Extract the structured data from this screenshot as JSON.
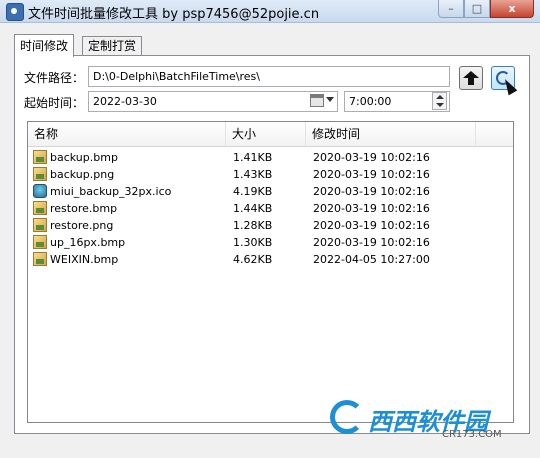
{
  "window": {
    "title": "文件时间批量修改工具 by psp7456@52pojie.cn",
    "minimize_glyph": "–",
    "maximize_glyph": "□",
    "close_glyph": "x"
  },
  "tabs": [
    {
      "label": "时间修改",
      "active": true
    },
    {
      "label": "定制打赏",
      "active": false
    }
  ],
  "form": {
    "path_label": "文件路径：",
    "path_value": "D:\\0-Delphi\\BatchFileTime\\res\\",
    "start_label": "起始时间：",
    "date_value": "2022-03-30",
    "time_value": "7:00:00"
  },
  "icons": {
    "up_button": "up-arrow-icon",
    "refresh_button": "refresh-icon",
    "date_picker": "calendar-icon"
  },
  "file_list": {
    "columns": [
      "名称",
      "大小",
      "修改时间"
    ],
    "rows": [
      {
        "name": "backup.bmp",
        "size": "1.41KB",
        "modified": "2020-03-19 10:02:16",
        "icon": "image-file-icon"
      },
      {
        "name": "backup.png",
        "size": "1.43KB",
        "modified": "2020-03-19 10:02:16",
        "icon": "image-file-icon"
      },
      {
        "name": "miui_backup_32px.ico",
        "size": "4.19KB",
        "modified": "2020-03-19 10:02:16",
        "icon": "ico-file-icon"
      },
      {
        "name": "restore.bmp",
        "size": "1.44KB",
        "modified": "2020-03-19 10:02:16",
        "icon": "image-file-icon"
      },
      {
        "name": "restore.png",
        "size": "1.28KB",
        "modified": "2020-03-19 10:02:16",
        "icon": "image-file-icon"
      },
      {
        "name": "up_16px.bmp",
        "size": "1.30KB",
        "modified": "2020-03-19 10:02:16",
        "icon": "image-file-icon"
      },
      {
        "name": "WEIXIN.bmp",
        "size": "4.62KB",
        "modified": "2022-04-05 10:27:00",
        "icon": "image-file-icon"
      }
    ]
  },
  "watermark": {
    "text": "西西软件园",
    "url": "CR173.COM"
  },
  "colors": {
    "titlebar": "#c9daef",
    "accent": "#1d8fd6",
    "close": "#c7432e"
  }
}
